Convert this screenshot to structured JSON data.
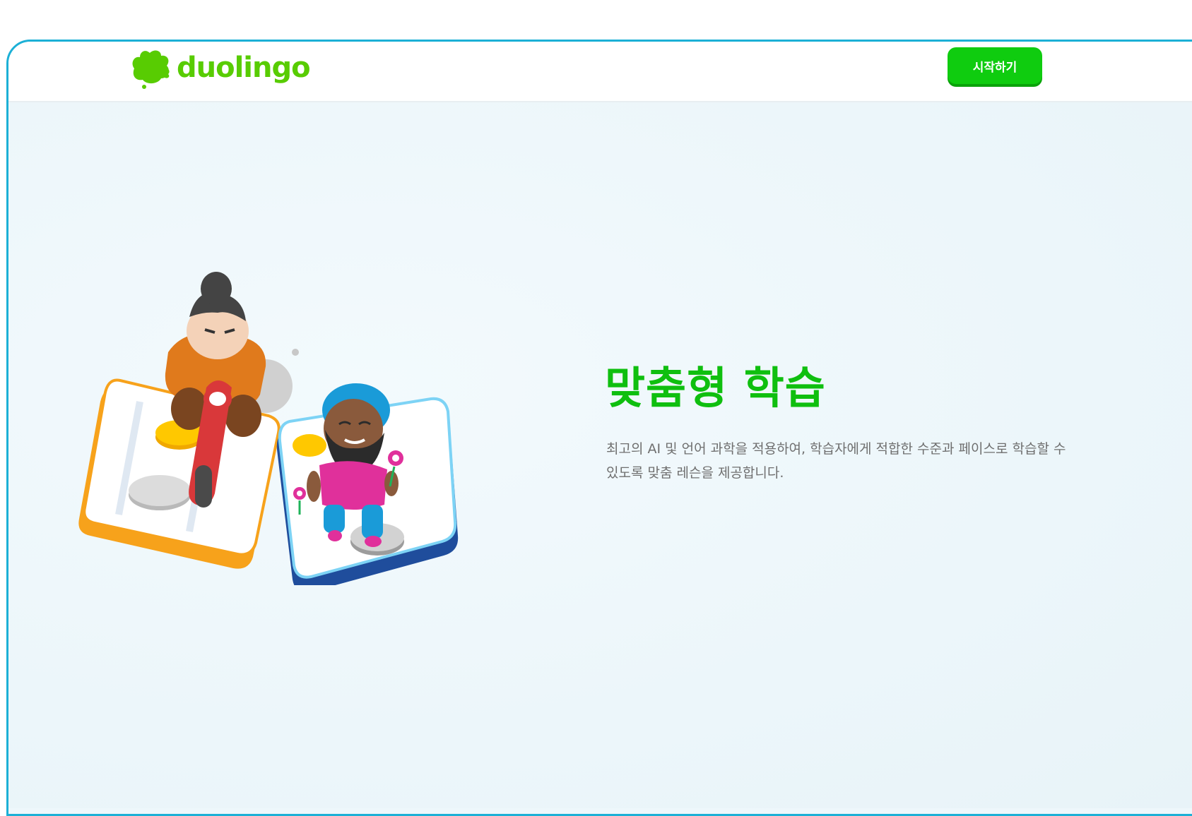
{
  "header": {
    "brand_name": "duolingo",
    "logo_icon": "duo-owl-logo-icon",
    "cta_label": "시작하기"
  },
  "hero": {
    "title": "맞춤형 학습",
    "description": "최고의 AI 및 언어 과학을 적용하여, 학습자에게 적합한 수준과 페이스로 학습할 수 있도록 맞춤 레슨을 제공합니다.",
    "illustration": "characters-on-lesson-tiles-illustration"
  },
  "colors": {
    "brand_green": "#58cc02",
    "button_green": "#0fcc0f",
    "title_green": "#0fbf0f",
    "frame_border": "#1cb0d6",
    "background": "#eef7fb",
    "text_gray": "#6f6f6f"
  }
}
